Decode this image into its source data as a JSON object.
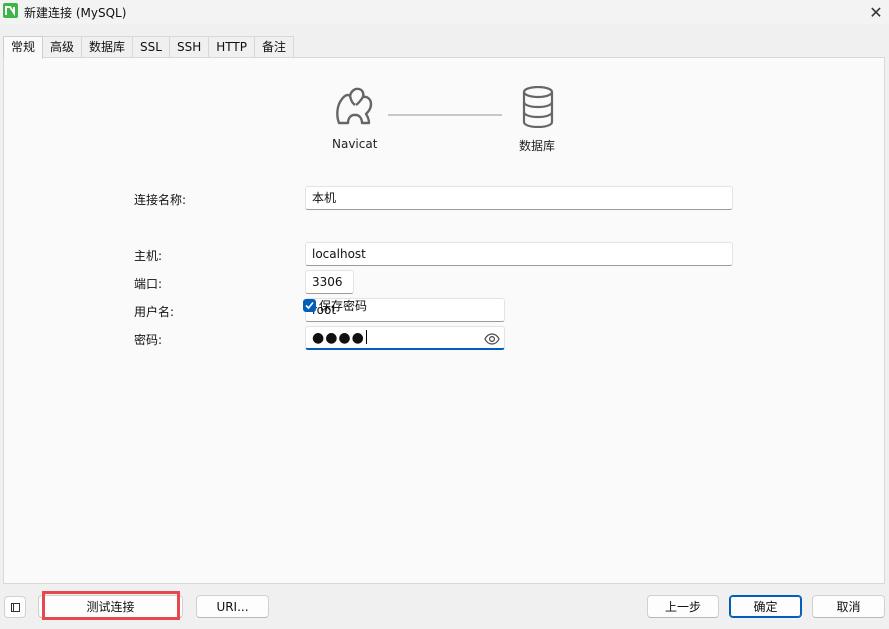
{
  "window": {
    "title": "新建连接 (MySQL)",
    "close_glyph": "✕"
  },
  "tabs": [
    {
      "label": "常规",
      "active": true
    },
    {
      "label": "高级"
    },
    {
      "label": "数据库"
    },
    {
      "label": "SSL"
    },
    {
      "label": "SSH"
    },
    {
      "label": "HTTP"
    },
    {
      "label": "备注"
    }
  ],
  "diagram": {
    "left_label": "Navicat",
    "right_label": "数据库",
    "left_icon": "navicat-logo-icon",
    "right_icon": "database-icon"
  },
  "form": {
    "connection_name": {
      "label": "连接名称:",
      "value": "本机"
    },
    "host": {
      "label": "主机:",
      "value": "localhost"
    },
    "port": {
      "label": "端口:",
      "value": "3306"
    },
    "username": {
      "label": "用户名:",
      "value": "root"
    },
    "password": {
      "label": "密码:",
      "masked": "●●●●",
      "reveal_icon": "eye-icon"
    },
    "save_password": {
      "label": "保存密码",
      "checked": true
    }
  },
  "footer": {
    "test_connection": "测试连接",
    "uri": "URI...",
    "previous": "上一步",
    "ok": "确定",
    "cancel": "取消"
  },
  "colors": {
    "accent": "#005fb8",
    "highlight": "#e5484d",
    "brand": "#3cb54a"
  }
}
